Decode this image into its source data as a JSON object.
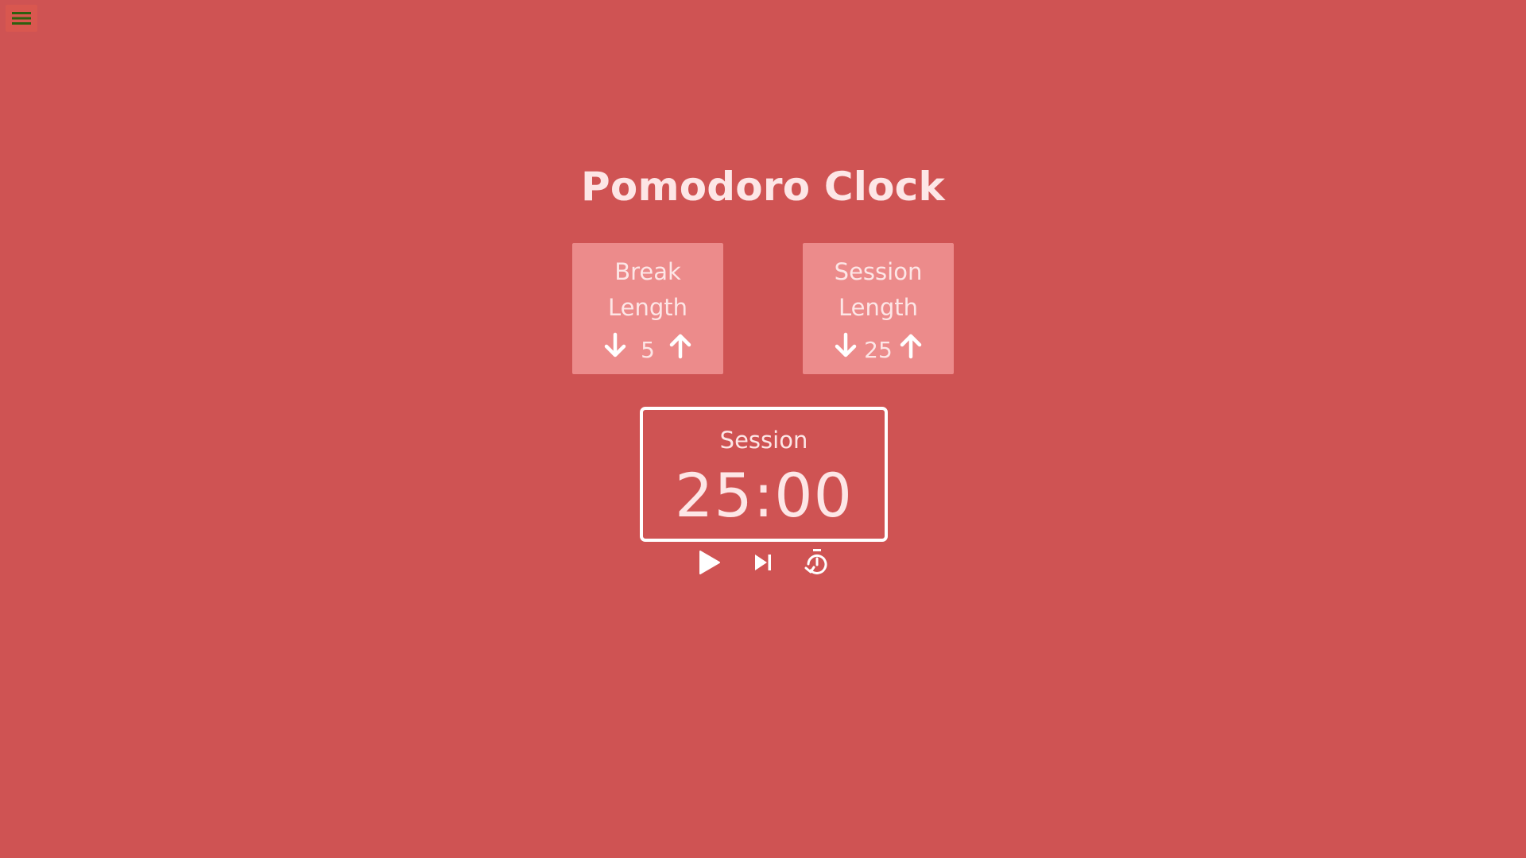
{
  "app": {
    "title": "Pomodoro Clock"
  },
  "menu": {
    "icon": "hamburger-menu-icon"
  },
  "break_length": {
    "label": "Break Length",
    "value": "5",
    "decrement_icon": "arrow-down-icon",
    "increment_icon": "arrow-up-icon"
  },
  "session_length": {
    "label": "Session Length",
    "value": "25",
    "decrement_icon": "arrow-down-icon",
    "increment_icon": "arrow-up-icon"
  },
  "timer": {
    "label": "Session",
    "time": "25:00"
  },
  "controls": {
    "play_icon": "play-icon",
    "skip_icon": "skip-next-icon",
    "reset_icon": "timer-reset-icon"
  },
  "colors": {
    "background": "#cf5353",
    "panel": "#ec8b8b",
    "text": "#fde6e6",
    "menu_lines": "#2f5f0f"
  }
}
